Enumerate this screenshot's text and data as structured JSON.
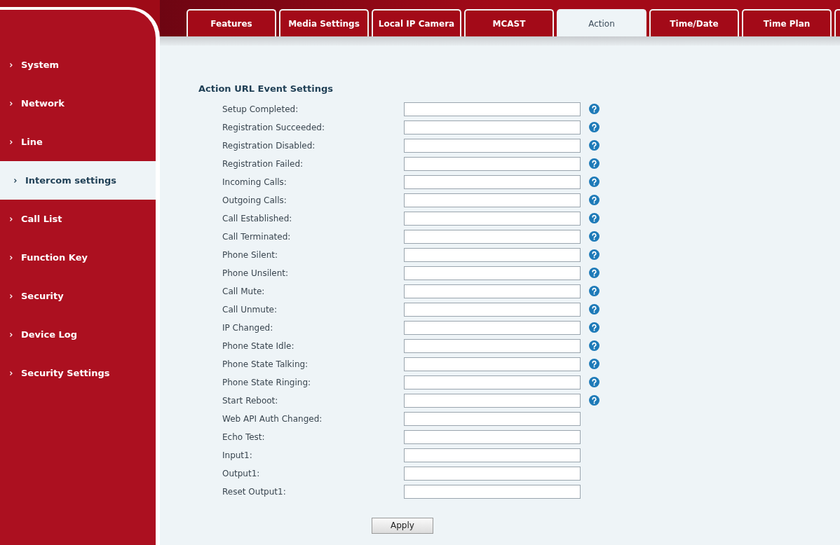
{
  "tabs": [
    {
      "label": "Features",
      "selected": false
    },
    {
      "label": "Media Settings",
      "selected": false
    },
    {
      "label": "Local IP Camera",
      "selected": false
    },
    {
      "label": "MCAST",
      "selected": false
    },
    {
      "label": "Action",
      "selected": true
    },
    {
      "label": "Time/Date",
      "selected": false
    },
    {
      "label": "Time Plan",
      "selected": false
    }
  ],
  "sidebar": {
    "items": [
      {
        "label": "System",
        "selected": false
      },
      {
        "label": "Network",
        "selected": false
      },
      {
        "label": "Line",
        "selected": false
      },
      {
        "label": "Intercom settings",
        "selected": true
      },
      {
        "label": "Call List",
        "selected": false
      },
      {
        "label": "Function Key",
        "selected": false
      },
      {
        "label": "Security",
        "selected": false
      },
      {
        "label": "Device Log",
        "selected": false
      },
      {
        "label": "Security Settings",
        "selected": false
      }
    ]
  },
  "section": {
    "title": "Action URL Event Settings",
    "fields": [
      {
        "label": "Setup Completed:",
        "help": true
      },
      {
        "label": "Registration Succeeded:",
        "help": true
      },
      {
        "label": "Registration Disabled:",
        "help": true
      },
      {
        "label": "Registration Failed:",
        "help": true
      },
      {
        "label": "Incoming Calls:",
        "help": true
      },
      {
        "label": "Outgoing Calls:",
        "help": true
      },
      {
        "label": "Call Established:",
        "help": true
      },
      {
        "label": "Call Terminated:",
        "help": true
      },
      {
        "label": "Phone Silent:",
        "help": true
      },
      {
        "label": "Phone Unsilent:",
        "help": true
      },
      {
        "label": "Call Mute:",
        "help": true
      },
      {
        "label": "Call Unmute:",
        "help": true
      },
      {
        "label": "IP Changed:",
        "help": true
      },
      {
        "label": "Phone State Idle:",
        "help": true
      },
      {
        "label": "Phone State Talking:",
        "help": true
      },
      {
        "label": "Phone State Ringing:",
        "help": true
      },
      {
        "label": "Start Reboot:",
        "help": true
      },
      {
        "label": "Web API Auth Changed:",
        "help": false
      },
      {
        "label": "Echo Test:",
        "help": false
      },
      {
        "label": "Input1:",
        "help": false
      },
      {
        "label": "Output1:",
        "help": false
      },
      {
        "label": "Reset Output1:",
        "help": false
      }
    ]
  },
  "apply_button": "Apply"
}
